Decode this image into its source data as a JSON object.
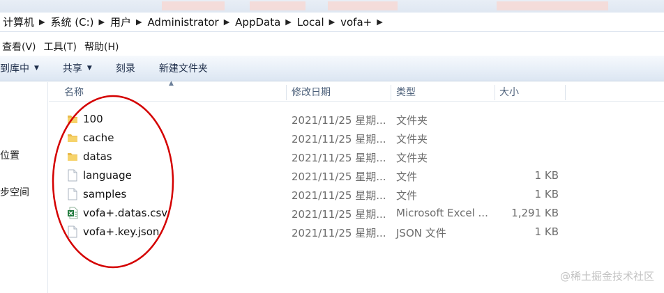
{
  "address": {
    "crumbs": [
      "计算机",
      "系统 (C:)",
      "用户",
      "Administrator",
      "AppData",
      "Local",
      "vofa+"
    ]
  },
  "menu": {
    "items": [
      "查看(V)",
      "工具(T)",
      "帮助(H)"
    ]
  },
  "toolbar": {
    "include_label": "到库中",
    "share_label": "共享",
    "burn_label": "刻录",
    "new_folder_label": "新建文件夹"
  },
  "nav": {
    "items": [
      "位置",
      "步空间"
    ]
  },
  "columns": {
    "name": "名称",
    "date": "修改日期",
    "type": "类型",
    "size": "大小"
  },
  "files": [
    {
      "icon": "folder-icon",
      "name": "100",
      "date": "2021/11/25 星期...",
      "type": "文件夹",
      "size": ""
    },
    {
      "icon": "folder-icon",
      "name": "cache",
      "date": "2021/11/25 星期...",
      "type": "文件夹",
      "size": ""
    },
    {
      "icon": "folder-icon",
      "name": "datas",
      "date": "2021/11/25 星期...",
      "type": "文件夹",
      "size": ""
    },
    {
      "icon": "file-icon",
      "name": "language",
      "date": "2021/11/25 星期...",
      "type": "文件",
      "size": "1 KB"
    },
    {
      "icon": "file-icon",
      "name": "samples",
      "date": "2021/11/25 星期...",
      "type": "文件",
      "size": "1 KB"
    },
    {
      "icon": "excel-file-icon",
      "name": "vofa+.datas.csv",
      "date": "2021/11/25 星期...",
      "type": "Microsoft Excel ...",
      "size": "1,291 KB"
    },
    {
      "icon": "file-icon",
      "name": "vofa+.key.json",
      "date": "2021/11/25 星期...",
      "type": "JSON 文件",
      "size": "1 KB"
    }
  ],
  "watermark": "@稀土掘金技术社区",
  "colors": {
    "annotation_circle": "#d40000",
    "folder": "#f2c94c",
    "excel": "#1f7a3c",
    "toolbar_bg": "#e9f0f8"
  }
}
